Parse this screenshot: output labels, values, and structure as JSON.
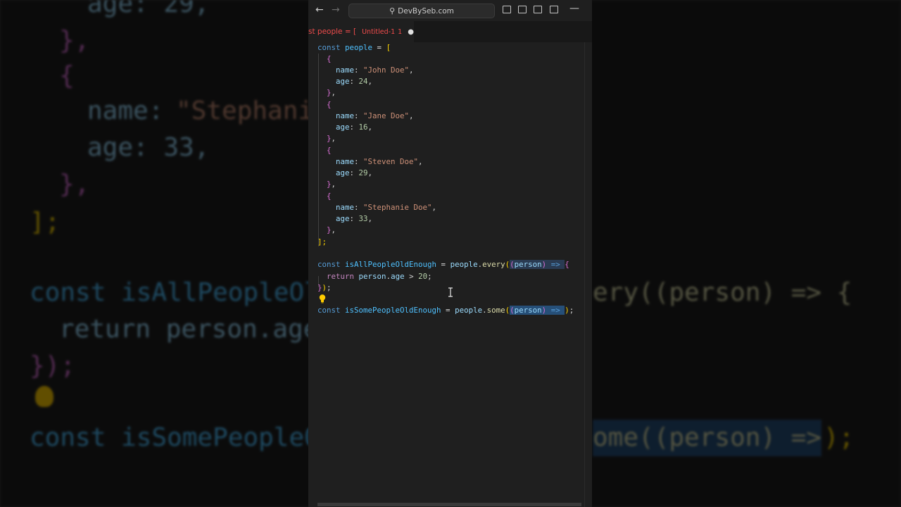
{
  "titlebar": {
    "search_text": "DevBySeb.com",
    "back_icon": "arrow-left-icon",
    "forward_icon": "arrow-right-icon",
    "minimize_symbol": "—"
  },
  "tab": {
    "code_preview": "st people = [",
    "file_name": "Untitled-1",
    "problem_count": "1",
    "dirty_symbol": "●"
  },
  "code": {
    "line1": {
      "kw": "const",
      "name": "people",
      "op": " = ",
      "bracket": "["
    },
    "p1": {
      "name_key": "name",
      "name_val": "\"John Doe\"",
      "age_key": "age",
      "age_val": "24"
    },
    "p2": {
      "name_key": "name",
      "name_val": "\"Jane Doe\"",
      "age_key": "age",
      "age_val": "16"
    },
    "p3": {
      "name_key": "name",
      "name_val": "\"Steven Doe\"",
      "age_key": "age",
      "age_val": "29"
    },
    "p4": {
      "name_key": "name",
      "name_val": "\"Stephanie Doe\"",
      "age_key": "age",
      "age_val": "33"
    },
    "close_array": "];",
    "every_line": {
      "kw": "const",
      "name": "isAllPeopleOldEnough",
      "obj": "people",
      "method": "every",
      "param": "person",
      "arrow": "=>"
    },
    "return_line": {
      "kw": "return",
      "obj": "person",
      "prop": "age",
      "op": " > ",
      "num": "20",
      "end": ";"
    },
    "every_close": "});",
    "some_line": {
      "kw": "const",
      "name": "isSomePeopleOldEnough",
      "obj": "people",
      "method": "some",
      "param": "person",
      "arrow": "=>"
    }
  },
  "background_text": {
    "l1": "age: 29,",
    "l2": "},",
    "l3": "{",
    "l4_key": "name:",
    "l4_val": "\"Stephani",
    "l5": "age: 33,",
    "l6": "},",
    "l7": "];",
    "l8": "const isAllPeopleOl",
    "l8_right": "ery((person) => {",
    "l9": "return person.age",
    "l10": "});",
    "l11": "const isSomePeopleO",
    "l11_right": "ome((person) =>",
    "l11_end": ");"
  },
  "colors": {
    "keyword": "#569cd6",
    "variable": "#4fc1ff",
    "string": "#ce9178",
    "number": "#b5cea8",
    "function": "#dcdcaa",
    "property": "#9cdcfe",
    "selection": "#264f78"
  }
}
